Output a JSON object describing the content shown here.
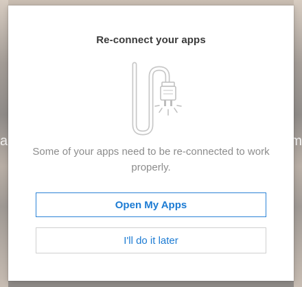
{
  "dialog": {
    "title": "Re-connect your apps",
    "message": "Some of your apps need to be re-connected to work properly.",
    "primary_button": "Open My Apps",
    "secondary_button": "I'll do it later"
  },
  "background": {
    "left_glyph": "a",
    "right_glyph": "m"
  },
  "icons": {
    "illustration": "unplugged-cable-icon"
  },
  "colors": {
    "accent": "#1c7bd3",
    "text_title": "#3a3a3a",
    "text_body": "#8c8c8c",
    "border_neutral": "#cfcfcf"
  }
}
